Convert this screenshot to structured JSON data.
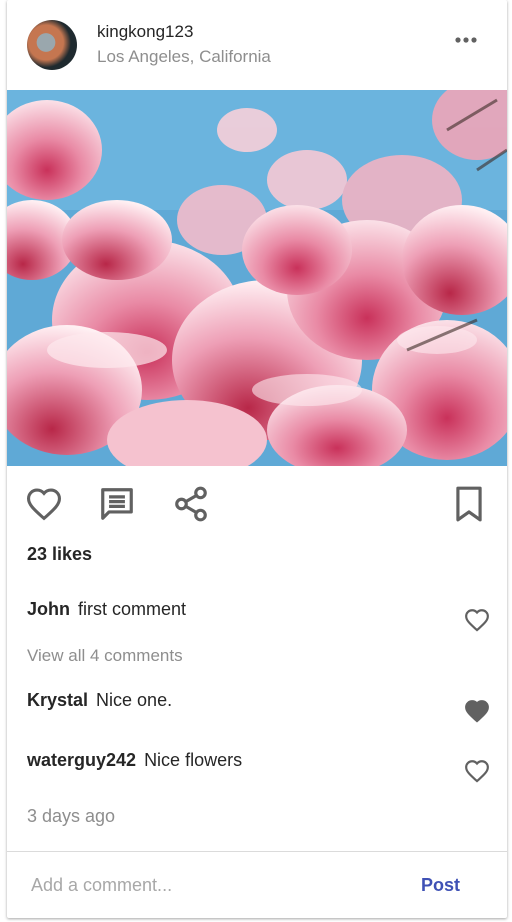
{
  "post": {
    "username": "kingkong123",
    "location": "Los Angeles, California",
    "likes_text": "23 likes",
    "view_all_text": "View all 4 comments",
    "time_ago": "3 days ago"
  },
  "comments": [
    {
      "user": "John",
      "text": "first comment",
      "liked": false
    },
    {
      "user": "Krystal",
      "text": "Nice one.",
      "liked": true
    },
    {
      "user": "waterguy242",
      "text": "Nice flowers",
      "liked": false
    }
  ],
  "add_comment": {
    "placeholder": "Add a comment...",
    "post_label": "Post"
  },
  "icons": [
    "more-horizontal-icon",
    "heart-outline-icon",
    "comment-icon",
    "share-icon",
    "bookmark-icon",
    "heart-filled-icon"
  ],
  "colors": {
    "text": "#262626",
    "muted": "#8e8e8e",
    "icon": "#616161",
    "post_button": "#3f51b5",
    "divider": "#dbdbdb"
  }
}
